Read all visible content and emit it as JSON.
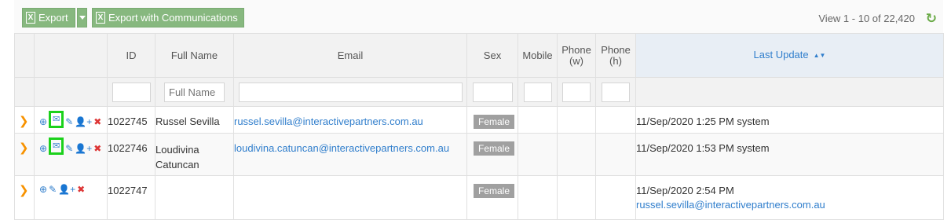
{
  "toolbar": {
    "export_label": "Export",
    "export_comm_label": "Export with Communications",
    "view_info": "View 1 - 10 of 22,420"
  },
  "columns": [
    "",
    "",
    "ID",
    "Full Name",
    "Email",
    "Sex",
    "Mobile",
    "Phone (w)",
    "Phone (h)",
    "Last Update"
  ],
  "column_labels": {
    "id": "ID",
    "full_name": "Full Name",
    "email": "Email",
    "sex": "Sex",
    "mobile": "Mobile",
    "phone_w": "Phone\n(w)",
    "phone_h": "Phone\n(h)",
    "last_update": "Last Update"
  },
  "filters": {
    "full_name_placeholder": "Full Name"
  },
  "rows": [
    {
      "id": "1022745",
      "full_name": "Russel Sevilla",
      "email": "russel.sevilla@interactivepartners.com.au",
      "sex": "Female",
      "last_update": "11/Sep/2020 1:25 PM system",
      "last_update_email": ""
    },
    {
      "id": "1022746",
      "full_name": "Loudivina Catuncan",
      "email": "loudivina.catuncan@interactivepartners.com.au",
      "sex": "Female",
      "last_update": "11/Sep/2020 1:53 PM system",
      "last_update_email": ""
    },
    {
      "id": "1022747",
      "full_name": "",
      "email": "",
      "sex": "Female",
      "last_update": "11/Sep/2020 2:54 PM",
      "last_update_email": "russel.sevilla@interactivepartners.com.au"
    }
  ],
  "icons": {
    "refresh": "refresh-icon",
    "expand": "chevron-right-icon",
    "view": "magnify-icon",
    "mail": "envelope-icon",
    "edit": "edit-icon",
    "add_user": "add-user-icon",
    "delete": "delete-icon"
  },
  "colors": {
    "green": "#87b87f",
    "accent": "#307ecc",
    "highlight": "#1bd11b",
    "expand": "#f79200",
    "delete": "#dd3535"
  }
}
